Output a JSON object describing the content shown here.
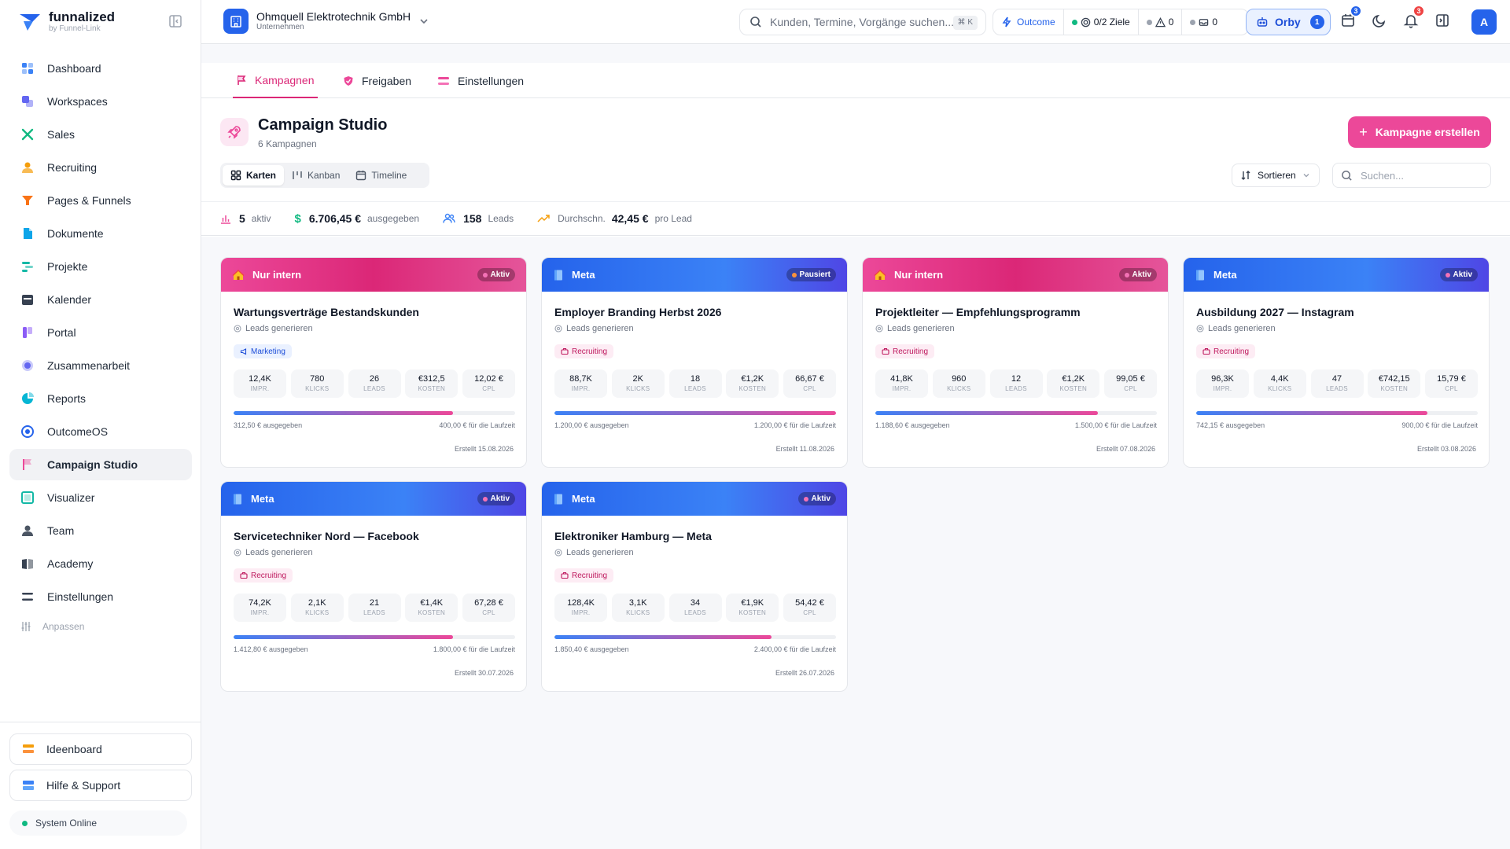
{
  "brand": {
    "name": "funnalized",
    "sub": "by Funnel-Link"
  },
  "sidebar": {
    "items": [
      {
        "label": "Dashboard",
        "icon": "dashboard-icon",
        "color": "#3b82f6"
      },
      {
        "label": "Workspaces",
        "icon": "workspaces-icon",
        "color": "#6366f1"
      },
      {
        "label": "Sales",
        "icon": "sales-icon",
        "color": "#10b981"
      },
      {
        "label": "Recruiting",
        "icon": "recruiting-icon",
        "color": "#f59e0b"
      },
      {
        "label": "Pages & Funnels",
        "icon": "funnel-icon",
        "color": "#f97316"
      },
      {
        "label": "Dokumente",
        "icon": "documents-icon",
        "color": "#0ea5e9"
      },
      {
        "label": "Projekte",
        "icon": "projects-icon",
        "color": "#14b8a6"
      },
      {
        "label": "Kalender",
        "icon": "calendar-icon",
        "color": "#374151"
      },
      {
        "label": "Portal",
        "icon": "portal-icon",
        "color": "#8b5cf6"
      },
      {
        "label": "Zusammenarbeit",
        "icon": "collaboration-icon",
        "color": "#6366f1"
      },
      {
        "label": "Reports",
        "icon": "reports-icon",
        "color": "#06b6d4"
      },
      {
        "label": "OutcomeOS",
        "icon": "outcome-icon",
        "color": "#2563eb"
      },
      {
        "label": "Campaign Studio",
        "icon": "campaign-flag-icon",
        "color": "#ec4899",
        "active": true
      },
      {
        "label": "Visualizer",
        "icon": "visualizer-icon",
        "color": "#14b8a6"
      },
      {
        "label": "Team",
        "icon": "team-icon",
        "color": "#4b5563"
      },
      {
        "label": "Academy",
        "icon": "academy-icon",
        "color": "#374151"
      },
      {
        "label": "Einstellungen",
        "icon": "settings-icon",
        "color": "#374151"
      }
    ],
    "customize": "Anpassen",
    "ideaboard": "Ideenboard",
    "help": "Hilfe & Support",
    "status": "System Online"
  },
  "topbar": {
    "org_name": "Ohmquell Elektrotechnik GmbH",
    "org_sub": "Unternehmen",
    "search_placeholder": "Kunden, Termine, Vorgänge suchen...",
    "search_kbd": "⌘ K",
    "outcome_label": "Outcome",
    "goals": "0/2 Ziele",
    "warnings": "0",
    "messages": "0",
    "orby_label": "Orby",
    "orby_count": "1",
    "calendar_badge": "3",
    "notif_badge": "3",
    "avatar": "A"
  },
  "tabs": [
    {
      "label": "Kampagnen",
      "active": true
    },
    {
      "label": "Freigaben"
    },
    {
      "label": "Einstellungen"
    }
  ],
  "page": {
    "title": "Campaign Studio",
    "subtitle": "6 Kampagnen",
    "create_label": "Kampagne erstellen",
    "views": [
      "Karten",
      "Kanban",
      "Timeline"
    ],
    "sort_label": "Sortieren",
    "search_placeholder": "Suchen..."
  },
  "stats": {
    "active_value": "5",
    "active_label": "aktiv",
    "spent_value": "6.706,45 €",
    "spent_label": "ausgegeben",
    "leads_value": "158",
    "leads_label": "Leads",
    "avg_prefix": "Durchschn.",
    "avg_value": "42,45 €",
    "avg_label": "pro Lead"
  },
  "metric_labels": [
    "IMPR.",
    "KLICKS",
    "LEADS",
    "KOSTEN",
    "CPL"
  ],
  "campaigns": [
    {
      "channel": "Nur intern",
      "theme": "pink",
      "status": "Aktiv",
      "status_color": "#f472b6",
      "title": "Wartungsverträge Bestandskunden",
      "goal": "Leads generieren",
      "tag": "Marketing",
      "tag_type": "mkt",
      "metrics": [
        "12,4K",
        "780",
        "26",
        "€312,5",
        "12,02 €"
      ],
      "progress": 0.78,
      "spent": "312,50 € ausgegeben",
      "budget": "400,00 € für die Laufzeit",
      "created": "Erstellt 15.08.2026"
    },
    {
      "channel": "Meta",
      "theme": "blue",
      "status": "Pausiert",
      "status_color": "#fb923c",
      "title": "Employer Branding Herbst 2026",
      "goal": "Leads generieren",
      "tag": "Recruiting",
      "tag_type": "rec",
      "metrics": [
        "88,7K",
        "2K",
        "18",
        "€1,2K",
        "66,67 €"
      ],
      "progress": 1.0,
      "spent": "1.200,00 € ausgegeben",
      "budget": "1.200,00 € für die Laufzeit",
      "created": "Erstellt 11.08.2026"
    },
    {
      "channel": "Nur intern",
      "theme": "pink",
      "status": "Aktiv",
      "status_color": "#f472b6",
      "title": "Projektleiter — Empfehlungsprogramm",
      "goal": "Leads generieren",
      "tag": "Recruiting",
      "tag_type": "rec",
      "metrics": [
        "41,8K",
        "960",
        "12",
        "€1,2K",
        "99,05 €"
      ],
      "progress": 0.79,
      "spent": "1.188,60 € ausgegeben",
      "budget": "1.500,00 € für die Laufzeit",
      "created": "Erstellt 07.08.2026"
    },
    {
      "channel": "Meta",
      "theme": "blue",
      "status": "Aktiv",
      "status_color": "#f472b6",
      "title": "Ausbildung 2027 — Instagram",
      "goal": "Leads generieren",
      "tag": "Recruiting",
      "tag_type": "rec",
      "metrics": [
        "96,3K",
        "4,4K",
        "47",
        "€742,15",
        "15,79 €"
      ],
      "progress": 0.82,
      "spent": "742,15 € ausgegeben",
      "budget": "900,00 € für die Laufzeit",
      "created": "Erstellt 03.08.2026"
    },
    {
      "channel": "Meta",
      "theme": "blue",
      "status": "Aktiv",
      "status_color": "#f472b6",
      "title": "Servicetechniker Nord — Facebook",
      "goal": "Leads generieren",
      "tag": "Recruiting",
      "tag_type": "rec",
      "metrics": [
        "74,2K",
        "2,1K",
        "21",
        "€1,4K",
        "67,28 €"
      ],
      "progress": 0.78,
      "spent": "1.412,80 € ausgegeben",
      "budget": "1.800,00 € für die Laufzeit",
      "created": "Erstellt 30.07.2026"
    },
    {
      "channel": "Meta",
      "theme": "blue",
      "status": "Aktiv",
      "status_color": "#f472b6",
      "title": "Elektroniker Hamburg — Meta",
      "goal": "Leads generieren",
      "tag": "Recruiting",
      "tag_type": "rec",
      "metrics": [
        "128,4K",
        "3,1K",
        "34",
        "€1,9K",
        "54,42 €"
      ],
      "progress": 0.77,
      "spent": "1.850,40 € ausgegeben",
      "budget": "2.400,00 € für die Laufzeit",
      "created": "Erstellt 26.07.2026"
    }
  ]
}
